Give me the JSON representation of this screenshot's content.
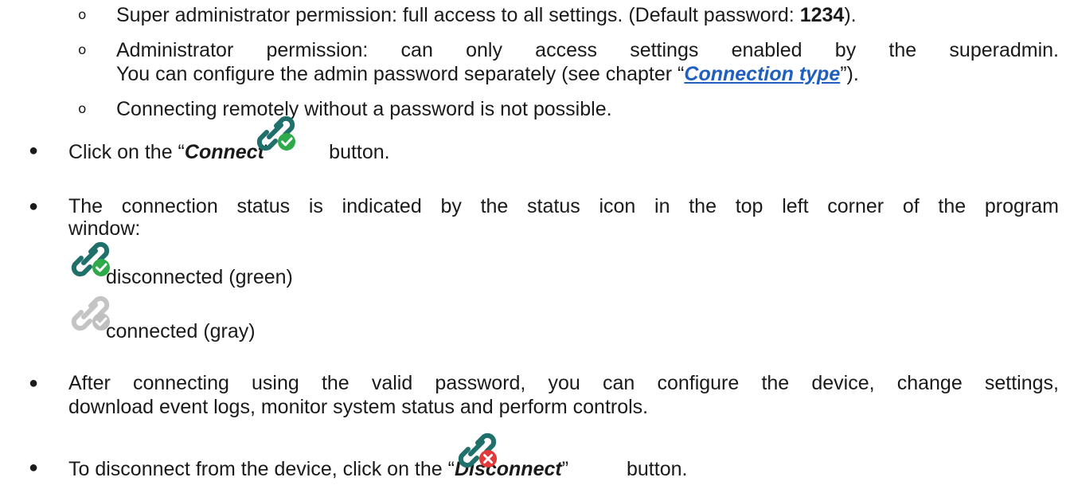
{
  "sub_items": [
    {
      "before": "Super administrator permission: full access to all settings. (Default password: ",
      "bold": "1234",
      "after": ")."
    },
    {
      "line1": "Administrator permission: can only access settings enabled by the superadmin.",
      "line2_before": "You can configure the admin password separately (see chapter “",
      "link": "Connection type",
      "line2_after": "”)."
    },
    {
      "text": "Connecting remotely without a password is not possible."
    }
  ],
  "connect_step": {
    "before": "Click on the “",
    "button_name": "Connect",
    "mid": "”",
    "after": " button."
  },
  "status_step": {
    "line1": "The connection status is indicated by the status icon in the top left corner of the program",
    "line2": "window:"
  },
  "status_legend": [
    {
      "label": "disconnected (green)",
      "icon": "link-green-check-icon"
    },
    {
      "label": "connected (gray)",
      "icon": "link-gray-check-icon"
    }
  ],
  "after_connect_step": {
    "line1": "After connecting using the valid password, you can configure the device, change settings,",
    "line2": "download event logs, monitor system status and perform controls."
  },
  "disconnect_step": {
    "before": "To disconnect from the device, click on the “",
    "button_name": "Disconnect",
    "mid": "”",
    "after": " button."
  },
  "colors": {
    "icon_teal": "#1f6f6a",
    "icon_green": "#2eaa4a",
    "icon_gray": "#bfbfbf",
    "icon_red": "#e23a3a",
    "link": "#1f5fbf"
  }
}
